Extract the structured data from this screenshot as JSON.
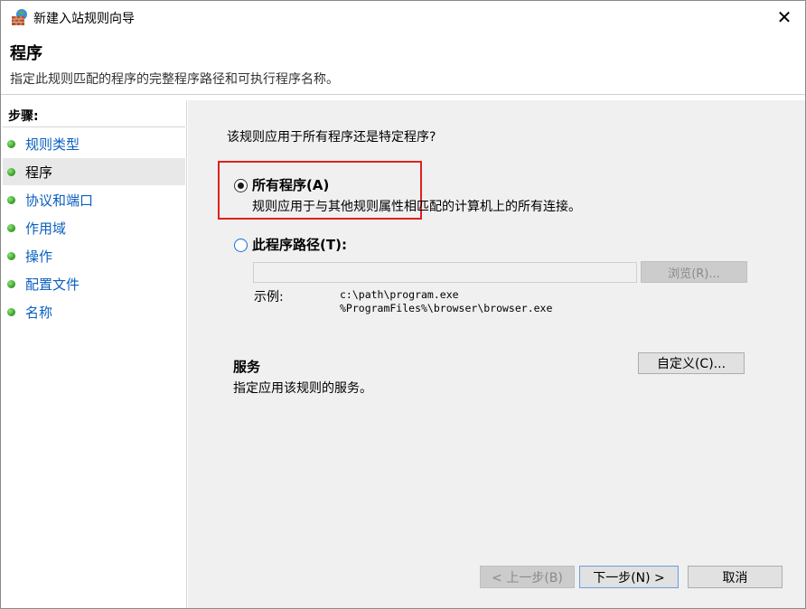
{
  "window": {
    "title": "新建入站规则向导",
    "close_symbol": "✕",
    "icon": "firewall-bricks-icon"
  },
  "header": {
    "title": "程序",
    "subtitle": "指定此规则匹配的程序的完整程序路径和可执行程序名称。"
  },
  "steps": {
    "heading": "步骤:",
    "items": [
      {
        "label": "规则类型",
        "current": false
      },
      {
        "label": "程序",
        "current": true
      },
      {
        "label": "协议和端口",
        "current": false
      },
      {
        "label": "作用域",
        "current": false
      },
      {
        "label": "操作",
        "current": false
      },
      {
        "label": "配置文件",
        "current": false
      },
      {
        "label": "名称",
        "current": false
      }
    ]
  },
  "content": {
    "question": "该规则应用于所有程序还是特定程序?",
    "all_programs": {
      "label": "所有程序(A)",
      "description": "规则应用于与其他规则属性相匹配的计算机上的所有连接。",
      "selected": true
    },
    "this_program": {
      "label": "此程序路径(T):",
      "selected": false,
      "path_value": "",
      "browse_label": "浏览(R)..."
    },
    "example": {
      "label": "示例:",
      "line1": "c:\\path\\program.exe",
      "line2": "%ProgramFiles%\\browser\\browser.exe"
    },
    "services": {
      "title": "服务",
      "description": "指定应用该规则的服务。",
      "customize_label": "自定义(C)..."
    }
  },
  "buttons": {
    "back": "< 上一步(B)",
    "next": "下一步(N) >",
    "cancel": "取消"
  },
  "colors": {
    "highlight_box": "#e02020",
    "step_link": "#0a5fc0",
    "content_bg": "#f0f0f0"
  }
}
